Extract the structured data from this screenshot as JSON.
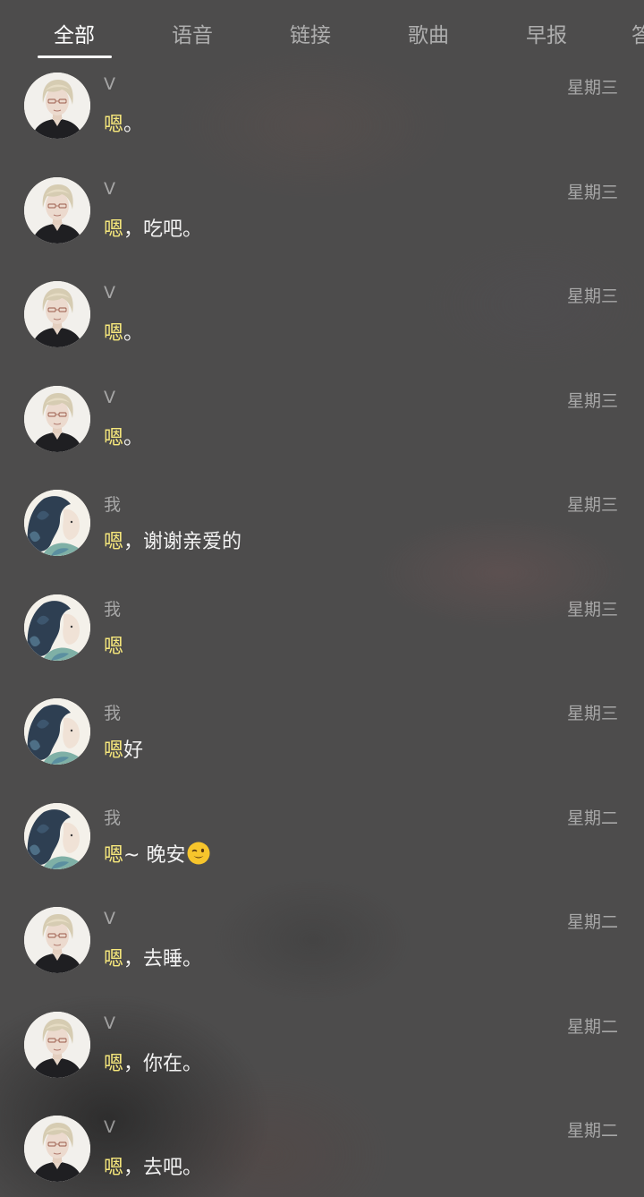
{
  "tabs": [
    "全部",
    "语音",
    "链接",
    "歌曲",
    "早报",
    "答"
  ],
  "active_tab": 0,
  "highlight_color": "#f7e87c",
  "messages": [
    {
      "avatar": "v-avatar-icon",
      "name": "V",
      "day": "星期三",
      "highlight": "嗯",
      "rest": "。"
    },
    {
      "avatar": "v-avatar-icon",
      "name": "V",
      "day": "星期三",
      "highlight": "嗯",
      "rest": "，吃吧。"
    },
    {
      "avatar": "v-avatar-icon",
      "name": "V",
      "day": "星期三",
      "highlight": "嗯",
      "rest": "。"
    },
    {
      "avatar": "v-avatar-icon",
      "name": "V",
      "day": "星期三",
      "highlight": "嗯",
      "rest": "。"
    },
    {
      "avatar": "me-avatar-icon",
      "name": "我",
      "day": "星期三",
      "highlight": "嗯",
      "rest": "，谢谢亲爱的"
    },
    {
      "avatar": "me-avatar-icon",
      "name": "我",
      "day": "星期三",
      "highlight": "嗯",
      "rest": ""
    },
    {
      "avatar": "me-avatar-icon",
      "name": "我",
      "day": "星期三",
      "highlight": "嗯",
      "rest": "好"
    },
    {
      "avatar": "me-avatar-icon",
      "name": "我",
      "day": "星期二",
      "highlight": "嗯",
      "rest": " ~ 晚安",
      "emoji": "wink-emoji-icon"
    },
    {
      "avatar": "v-avatar-icon",
      "name": "V",
      "day": "星期二",
      "highlight": "嗯",
      "rest": "，去睡。"
    },
    {
      "avatar": "v-avatar-icon",
      "name": "V",
      "day": "星期二",
      "highlight": "嗯",
      "rest": "，你在。"
    },
    {
      "avatar": "v-avatar-icon",
      "name": "V",
      "day": "星期二",
      "highlight": "嗯",
      "rest": "，去吧。"
    }
  ]
}
